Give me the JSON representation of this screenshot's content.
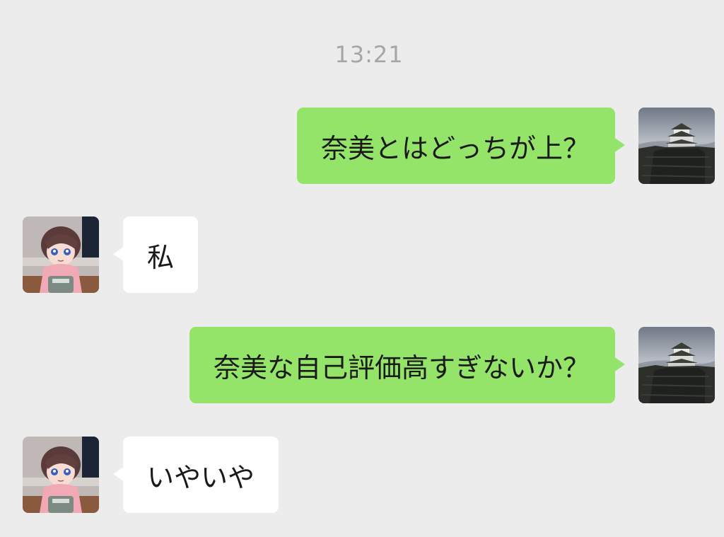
{
  "chat": {
    "timestamp": "13:21",
    "messages": [
      {
        "sender": "me",
        "text": "奈美とはどっちが上？",
        "avatar": "castle-avatar-icon"
      },
      {
        "sender": "other",
        "text": "私",
        "avatar": "anime-girl-avatar-icon"
      },
      {
        "sender": "me",
        "text": "奈美な自己評価高すぎないか？",
        "avatar": "castle-avatar-icon"
      },
      {
        "sender": "other",
        "text": "いやいや",
        "avatar": "anime-girl-avatar-icon"
      }
    ]
  },
  "colors": {
    "background": "#ececec",
    "sent_bubble": "#95e46a",
    "received_bubble": "#ffffff",
    "timestamp_text": "#a6a6a6"
  }
}
